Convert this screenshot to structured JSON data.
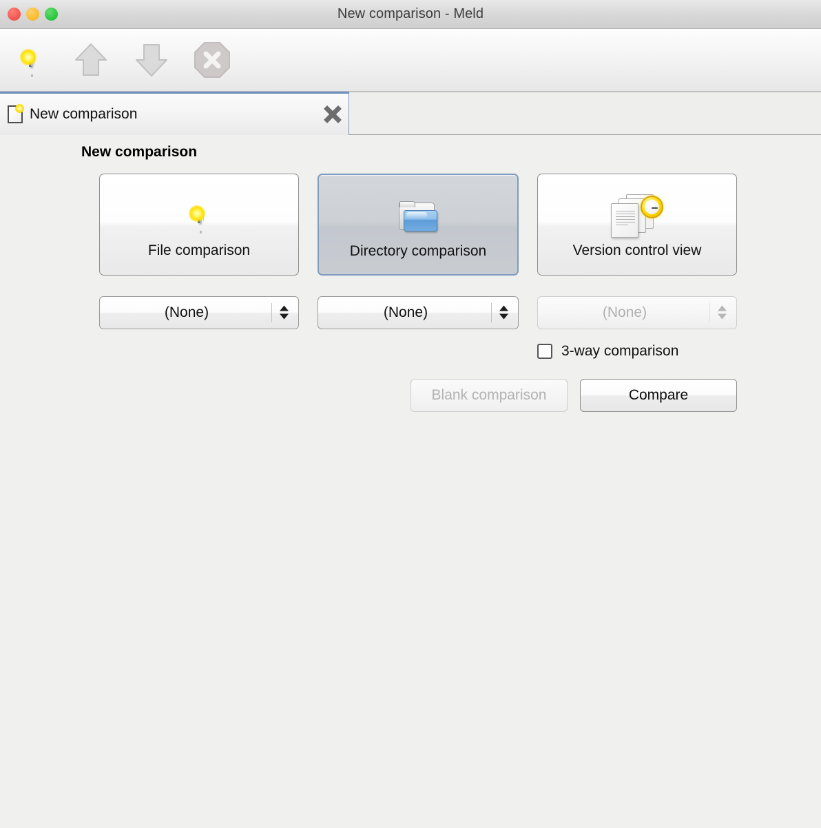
{
  "window": {
    "title": "New comparison - Meld",
    "traffic_lights": [
      {
        "name": "close",
        "color": "#f3564f"
      },
      {
        "name": "minimize",
        "color": "#fbbc2e"
      },
      {
        "name": "maximize",
        "color": "#2ac73f"
      }
    ]
  },
  "toolbar": {
    "items": [
      {
        "icon": "new-comparison-icon",
        "enabled": true
      },
      {
        "icon": "arrow-up-icon",
        "enabled": false
      },
      {
        "icon": "arrow-down-icon",
        "enabled": false
      },
      {
        "icon": "stop-icon",
        "enabled": false
      }
    ]
  },
  "tabs": [
    {
      "label": "New comparison",
      "active": true,
      "close_icon": "close-icon"
    }
  ],
  "main": {
    "heading": "New comparison",
    "comparison_types": [
      {
        "id": "file",
        "label": "File comparison",
        "icon": "document-icon",
        "selected": false
      },
      {
        "id": "directory",
        "label": "Directory comparison",
        "icon": "folder-icon",
        "selected": true
      },
      {
        "id": "vcs",
        "label": "Version control view",
        "icon": "version-control-icon",
        "selected": false
      }
    ],
    "combos": [
      {
        "id": "combo-1",
        "value": "(None)",
        "enabled": true
      },
      {
        "id": "combo-2",
        "value": "(None)",
        "enabled": true
      },
      {
        "id": "combo-3",
        "value": "(None)",
        "enabled": false
      }
    ],
    "three_way": {
      "label": "3-way comparison",
      "checked": false
    },
    "actions": {
      "blank_label": "Blank comparison",
      "blank_enabled": false,
      "compare_label": "Compare",
      "compare_enabled": true
    }
  },
  "colors": {
    "background": "#f0f0ee",
    "selection_border": "#7f9bc0",
    "tab_active_top": "#6e8fbd",
    "folder_blue": "#8fc0ea",
    "sparkle_yellow": "#ffd900"
  }
}
